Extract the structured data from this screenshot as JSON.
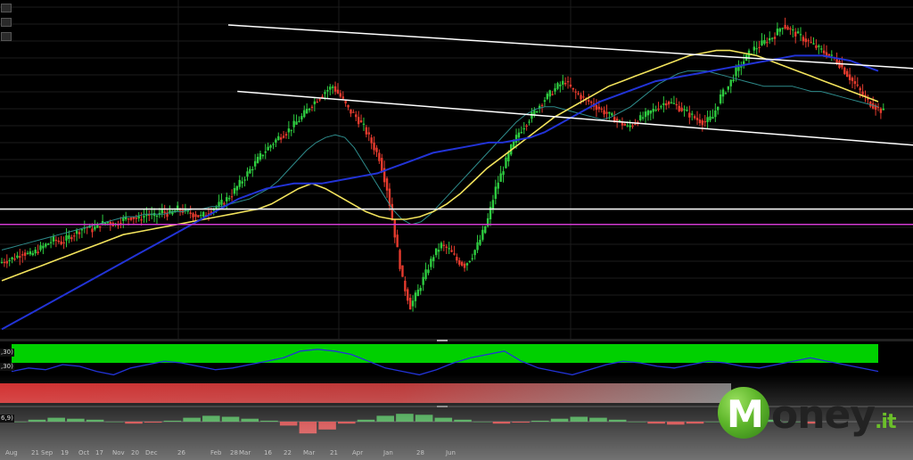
{
  "toolbar": {
    "buttons": [
      "chart-tool-1",
      "chart-tool-2",
      "chart-tool-3"
    ]
  },
  "indicator_panes": {
    "pane1_label": ",30)",
    "pane2_label": ",30)",
    "pane3_label": "6,9)"
  },
  "colors": {
    "background": "#000000",
    "bull_candle": "#2ecc40",
    "bear_candle": "#e63b2e",
    "sma_fast": "#2e8b8b",
    "sma_mid": "#f2e35c",
    "sma_slow": "#2233d6",
    "trendline": "#ffffff",
    "support_line": "#ffffff",
    "magenta_line": "#d23ad2",
    "indicator_band_green": "#00d000",
    "indicator_band_red": "#c83030",
    "indicator_line": "#2233d6"
  },
  "chart_data": {
    "type": "candlestick",
    "title": "",
    "xlabel": "",
    "ylabel": "",
    "x_tick_labels": [
      "Aug",
      "21",
      "Sep",
      "19",
      "Oct",
      "17",
      "Nov",
      "20",
      "Dec",
      "26",
      "Feb",
      "28",
      "Mar",
      "16",
      "22",
      "Mar",
      "21",
      "Apr",
      "Jan",
      "28",
      "Jun"
    ],
    "series_price_close": [
      30,
      31,
      33,
      32,
      34,
      36,
      38,
      37,
      39,
      41,
      43,
      42,
      44,
      45,
      44,
      46,
      47,
      46,
      48,
      47,
      49,
      48,
      50,
      49,
      48,
      47,
      49,
      51,
      53,
      56,
      60,
      64,
      68,
      72,
      75,
      78,
      80,
      83,
      86,
      90,
      93,
      96,
      98,
      94,
      89,
      86,
      82,
      76,
      70,
      58,
      40,
      22,
      12,
      18,
      25,
      32,
      36,
      34,
      30,
      28,
      32,
      38,
      46,
      58,
      66,
      74,
      80,
      84,
      88,
      92,
      95,
      98,
      100,
      96,
      94,
      92,
      90,
      88,
      86,
      84,
      82,
      84,
      86,
      88,
      90,
      92,
      91,
      89,
      87,
      85,
      84,
      86,
      94,
      98,
      104,
      108,
      112,
      114,
      116,
      118,
      122,
      120,
      118,
      116,
      114,
      112,
      110,
      108,
      104,
      100,
      96,
      92,
      90,
      88
    ],
    "sma_fast": [
      34,
      35,
      36,
      37,
      38,
      39,
      40,
      41,
      42,
      43,
      44,
      45,
      46,
      47,
      47,
      48,
      48,
      48,
      49,
      49,
      50,
      50,
      51,
      51,
      52,
      53,
      54,
      56,
      58,
      61,
      65,
      69,
      73,
      76,
      78,
      79,
      78,
      74,
      68,
      62,
      56,
      50,
      46,
      44,
      45,
      48,
      52,
      56,
      60,
      64,
      68,
      72,
      76,
      80,
      84,
      87,
      89,
      90,
      90,
      89,
      88,
      87,
      86,
      85,
      86,
      88,
      90,
      93,
      96,
      99,
      101,
      103,
      104,
      104,
      104,
      103,
      102,
      101,
      100,
      99,
      98,
      98,
      98,
      98,
      97,
      96,
      96,
      95,
      94,
      93,
      92,
      91,
      90
    ],
    "sma_mid": [
      22,
      24,
      26,
      28,
      30,
      32,
      34,
      36,
      38,
      40,
      41,
      42,
      43,
      44,
      45,
      46,
      47,
      48,
      49,
      50,
      52,
      55,
      58,
      60,
      58,
      55,
      52,
      49,
      47,
      46,
      46,
      47,
      49,
      52,
      56,
      61,
      66,
      70,
      74,
      78,
      82,
      86,
      89,
      92,
      95,
      98,
      100,
      102,
      104,
      106,
      108,
      110,
      111,
      112,
      112,
      111,
      110,
      108,
      106,
      104,
      102,
      100,
      98,
      96,
      94,
      92
    ],
    "sma_slow": [
      3,
      6,
      9,
      12,
      15,
      18,
      21,
      24,
      27,
      30,
      33,
      36,
      39,
      42,
      45,
      48,
      51,
      54,
      56,
      58,
      59,
      60,
      60,
      60,
      61,
      62,
      63,
      64,
      66,
      68,
      70,
      72,
      73,
      74,
      75,
      76,
      76,
      77,
      78,
      80,
      83,
      86,
      89,
      92,
      94,
      96,
      98,
      100,
      101,
      102,
      103,
      104,
      105,
      106,
      107,
      108,
      109,
      110,
      110,
      110,
      109,
      108,
      106,
      104
    ],
    "trendlines": [
      {
        "name": "upper",
        "from": [
          0.25,
          122
        ],
        "to": [
          1.0,
          105
        ]
      },
      {
        "name": "lower",
        "from": [
          0.26,
          96
        ],
        "to": [
          1.0,
          75
        ]
      }
    ],
    "horizontal_lines": [
      {
        "name": "support",
        "value": 50
      },
      {
        "name": "magenta",
        "value": 44
      }
    ],
    "indicator1": {
      "type": "band_with_line",
      "band_color": "green",
      "values": [
        0.3,
        0.4,
        0.35,
        0.5,
        0.45,
        0.3,
        0.2,
        0.4,
        0.5,
        0.6,
        0.55,
        0.45,
        0.35,
        0.4,
        0.5,
        0.6,
        0.7,
        0.9,
        0.95,
        0.9,
        0.8,
        0.6,
        0.4,
        0.3,
        0.2,
        0.35,
        0.55,
        0.7,
        0.8,
        0.9,
        0.6,
        0.4,
        0.3,
        0.2,
        0.35,
        0.5,
        0.6,
        0.55,
        0.45,
        0.4,
        0.5,
        0.6,
        0.55,
        0.45,
        0.4,
        0.5,
        0.6,
        0.7,
        0.6,
        0.5,
        0.4,
        0.3
      ]
    },
    "indicator2": {
      "type": "band",
      "band_color": "red"
    },
    "indicator3": {
      "type": "macd_histogram",
      "values": [
        0,
        0.1,
        0.2,
        0.15,
        0.1,
        0,
        -0.1,
        -0.05,
        0.05,
        0.2,
        0.3,
        0.25,
        0.15,
        0.05,
        -0.2,
        -0.6,
        -0.4,
        -0.1,
        0.1,
        0.3,
        0.4,
        0.35,
        0.2,
        0.1,
        0,
        -0.1,
        -0.05,
        0.05,
        0.15,
        0.25,
        0.2,
        0.1,
        0,
        -0.1,
        -0.15,
        -0.1,
        0,
        0.1,
        0.15,
        0.1,
        0,
        -0.1
      ]
    }
  },
  "logo": {
    "letter": "M",
    "word": "oney",
    "suffix": ".it"
  }
}
